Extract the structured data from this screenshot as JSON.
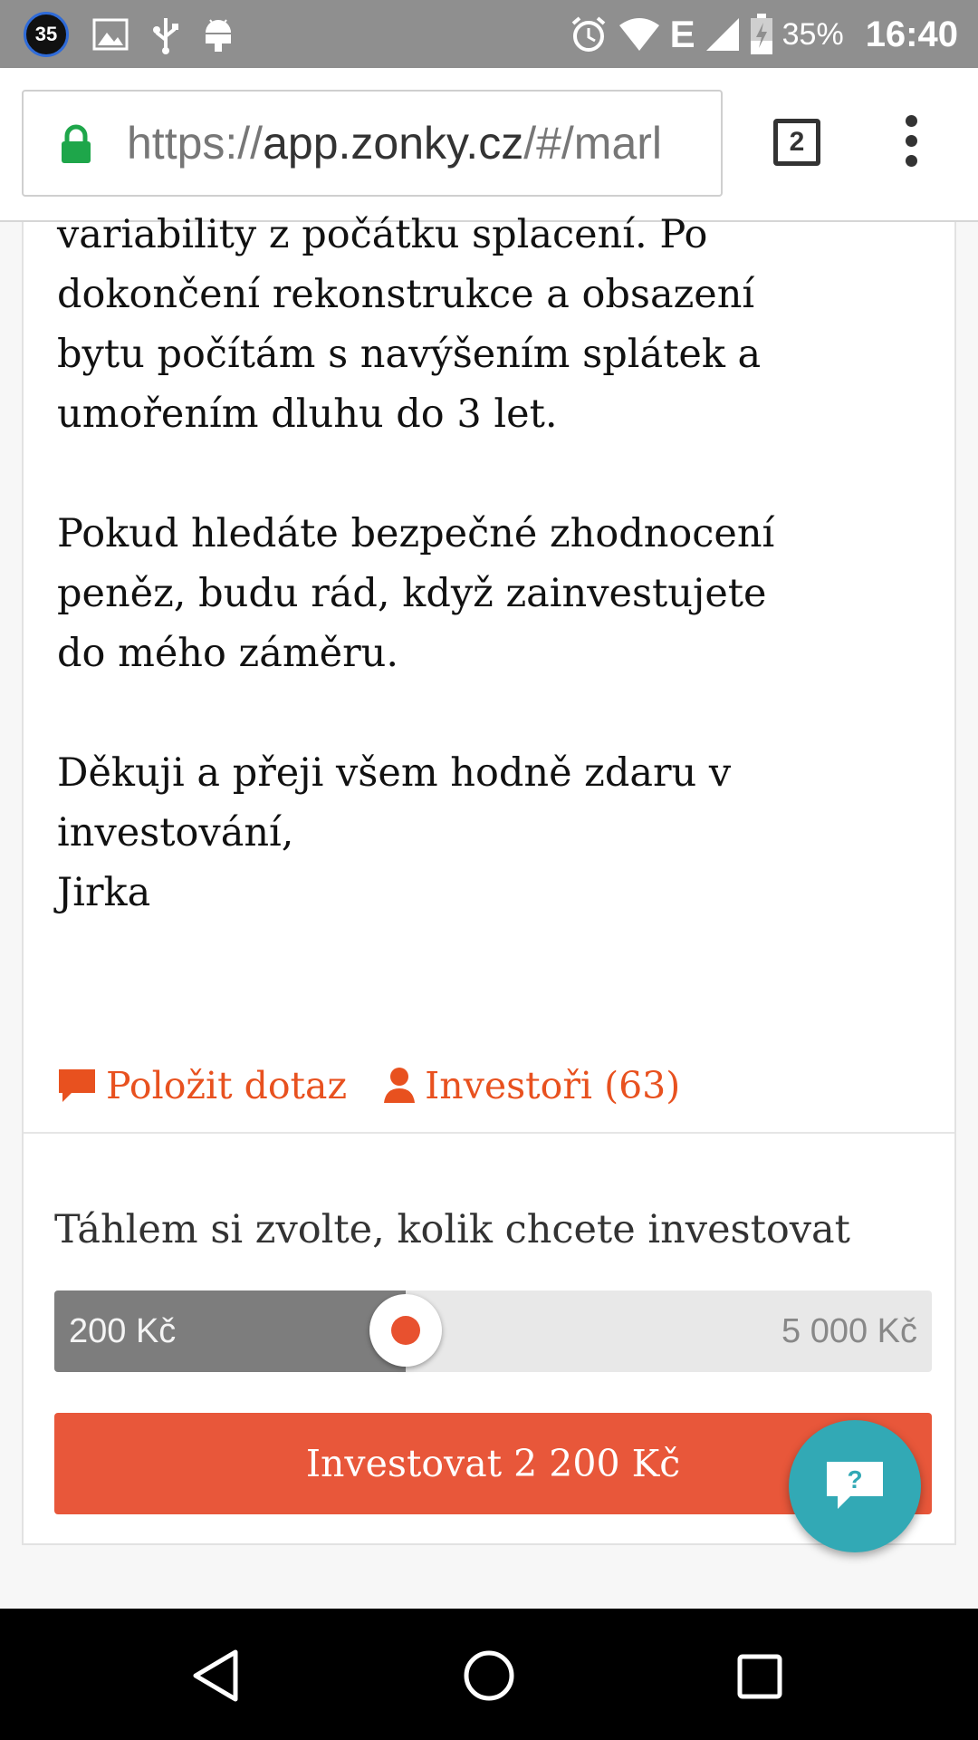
{
  "status_bar": {
    "notification_count": "35",
    "network_type": "E",
    "battery_percent": "35%",
    "time": "16:40"
  },
  "browser": {
    "url_prefix": "https://",
    "url_host": "app.zonky.cz",
    "url_rest": "/#/marl",
    "tab_count": "2"
  },
  "story": {
    "lines_block1": [
      "variability z počátku splacení. Po",
      "dokončení rekonstrukce a obsazení",
      "bytu počítám s navýšením splátek a",
      "umořením dluhu do 3 let."
    ],
    "lines_block2": [
      "Pokud hledáte bezpečné zhodnocení",
      "peněz, budu rád, když zainvestujete",
      "do mého záměru."
    ],
    "lines_block3": [
      "Děkuji a přeji všem hodně zdaru v",
      "investování,",
      "Jirka"
    ]
  },
  "links": {
    "ask_question": "Položit dotaz",
    "investors": "Investoři (63)"
  },
  "invest": {
    "label": "Táhlem si zvolte, kolik chcete investovat",
    "slider_min_label": "200 Kč",
    "slider_max_label": "5 000 Kč",
    "slider_value_fraction": 0.4,
    "button_label": "Investovat 2 200 Kč",
    "accent_color": "#e8573a"
  },
  "help": {
    "icon": "question-chat-icon",
    "color": "#32a9b5"
  }
}
